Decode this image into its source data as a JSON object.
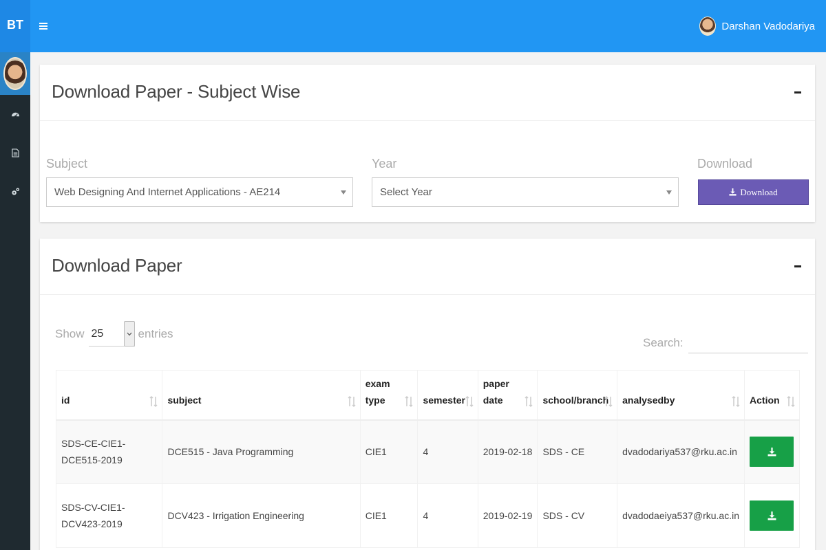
{
  "brand": "BT",
  "user": {
    "name": "Darshan Vadodariya"
  },
  "sidebar": {
    "items": [
      {
        "icon": "dashboard-icon"
      },
      {
        "icon": "document-icon"
      },
      {
        "icon": "settings-icon"
      }
    ]
  },
  "subject_card": {
    "title": "Download Paper - Subject Wise",
    "subject_label": "Subject",
    "subject_value": "Web Designing And Internet Applications - AE214",
    "year_label": "Year",
    "year_value": "Select Year",
    "download_label": "Download",
    "download_button": "Download"
  },
  "paper_card": {
    "title": "Download Paper",
    "show_label": "Show",
    "entries_value": "25",
    "entries_label": "entries",
    "search_label": "Search:",
    "columns": {
      "id": "id",
      "subject": "subject",
      "exam_type_1": "exam",
      "exam_type_2": "type",
      "semester": "semester",
      "paper_date_1": "paper",
      "paper_date_2": "date",
      "school_branch": "school/branch",
      "analysedby": "analysedby",
      "action": "Action"
    },
    "rows": [
      {
        "id_1": "SDS-CE-CIE1-",
        "id_2": "DCE515-2019",
        "subject": "DCE515 - Java Programming",
        "exam_type": "CIE1",
        "semester": "4",
        "paper_date": "2019-02-18",
        "school_branch": "SDS - CE",
        "analysedby": "dvadodariya537@rku.ac.in"
      },
      {
        "id_1": "SDS-CV-CIE1-",
        "id_2": "DCV423-2019",
        "subject": "DCV423 - Irrigation Engineering",
        "exam_type": "CIE1",
        "semester": "4",
        "paper_date": "2019-02-19",
        "school_branch": "SDS - CV",
        "analysedby": "dvadodaeiya537@rku.ac.in"
      }
    ]
  },
  "colors": {
    "topbar": "#2196f3",
    "sidebar": "#1f2a30",
    "download_button": "#6b5bb5",
    "row_download": "#17a047"
  }
}
